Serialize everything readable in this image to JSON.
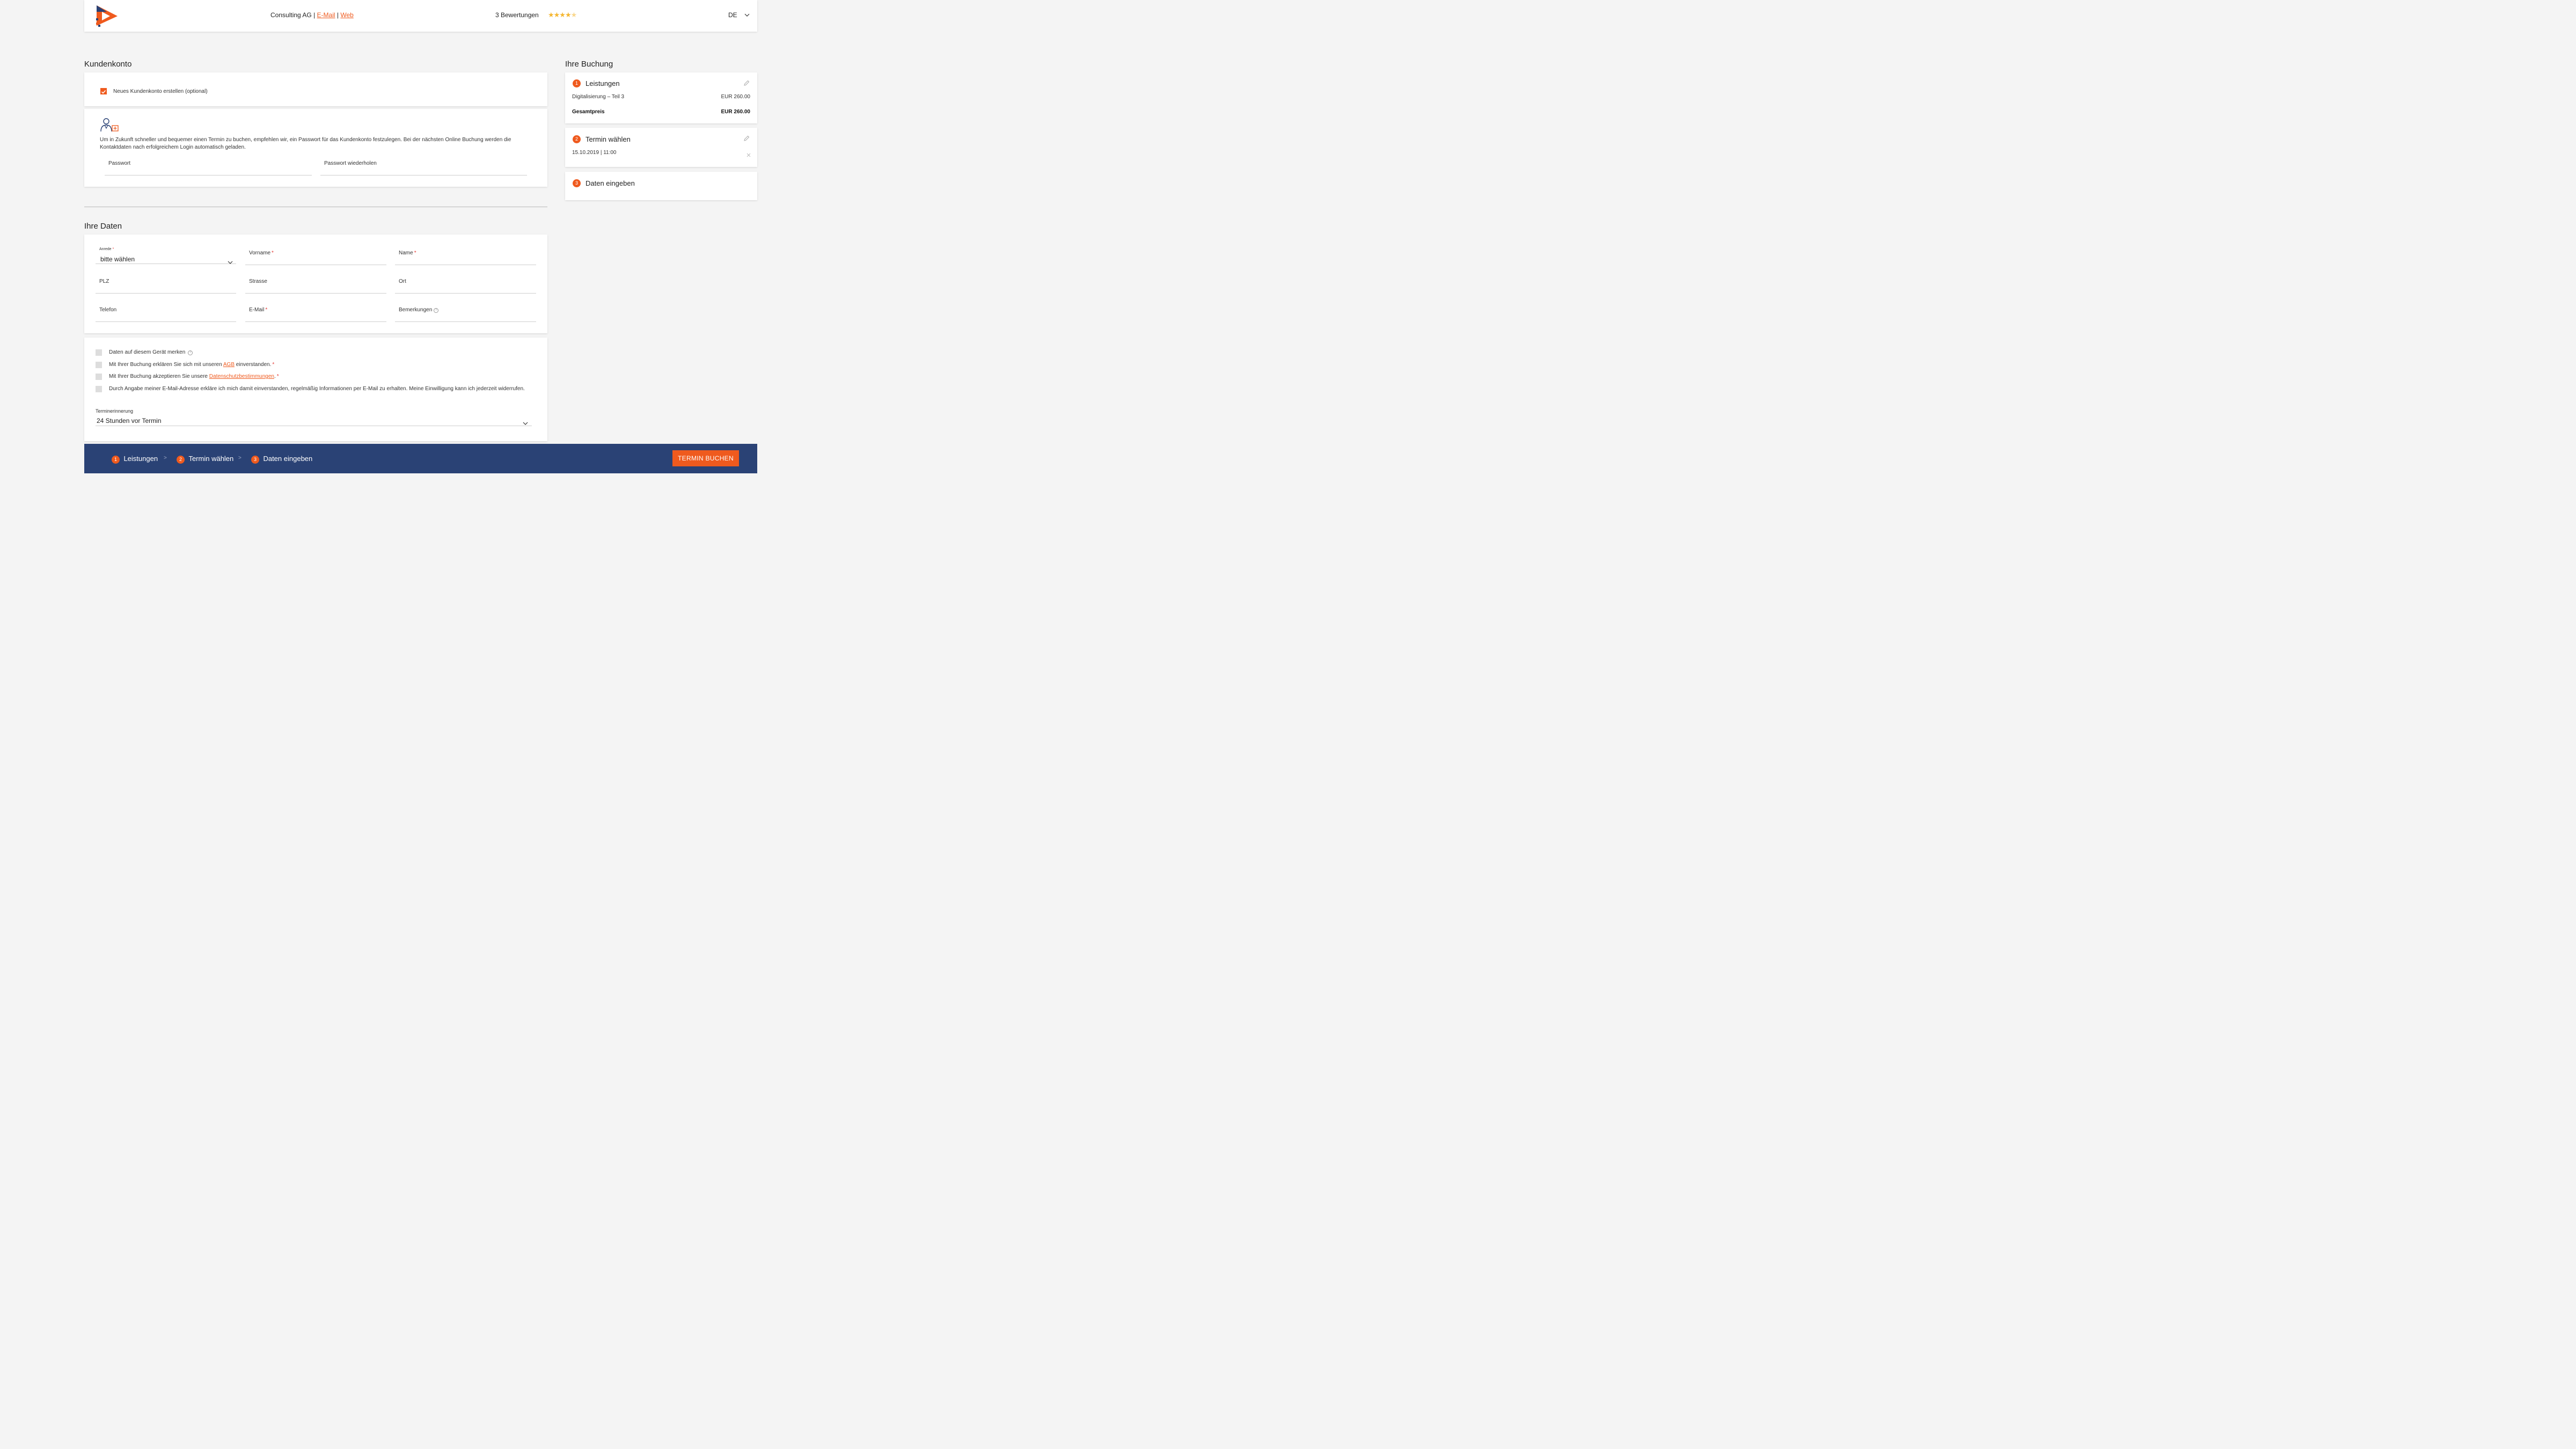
{
  "header": {
    "company": "Consulting AG",
    "sep": "|",
    "email_link": "E-Mail",
    "web_link": "Web",
    "ratings_text": "3 Bewertungen",
    "rating_stars": 4.5,
    "language": "DE"
  },
  "account": {
    "title": "Kundenkonto",
    "create_checkbox_label": "Neues Kundenkonto erstellen (optional)",
    "create_checked": true,
    "info_text": "Um in Zukunft schneller und bequemer einen Termin zu buchen, empfehlen wir, ein Passwort für das Kundenkonto festzulegen. Bei der nächsten Online Buchung werden die Kontaktdaten nach erfolgreichem Login automatisch geladen.",
    "password_label": "Passwort",
    "password_repeat_label": "Passwort wiederholen"
  },
  "data": {
    "title": "Ihre Daten",
    "salutation_label": "Anrede",
    "salutation_value": "bitte wählen",
    "firstname_label": "Vorname",
    "lastname_label": "Name",
    "zip_label": "PLZ",
    "street_label": "Strasse",
    "city_label": "Ort",
    "phone_label": "Telefon",
    "email_label": "E-Mail",
    "remarks_label": "Bemerkungen",
    "required_mark": "*"
  },
  "consents": {
    "remember": "Daten auf diesem Gerät merken",
    "agb_prefix": "Mit Ihrer Buchung erklären Sie sich mit unseren",
    "agb_link": "AGB",
    "agb_suffix": "einverstanden.",
    "privacy_prefix": "Mit Ihrer Buchung akzeptieren Sie unsere",
    "privacy_link": "Datenschutzbestimmungen",
    "privacy_suffix": ".",
    "newsletter": "Durch Angabe meiner E-Mail-Adresse erkläre ich mich damit einverstanden, regelmäßig Informationen per E-Mail zu erhalten. Meine Einwilligung kann ich jederzeit widerrufen.",
    "reminder_label": "Terminerinnerung",
    "reminder_value": "24 Stunden vor Termin"
  },
  "booking": {
    "title": "Ihre Buchung",
    "steps": [
      {
        "num": "1",
        "title": "Leistungen",
        "item": "Digitalisierung – Teil 3",
        "item_price": "EUR 260.00",
        "total_label": "Gesamtpreis",
        "total_price": "EUR 260.00"
      },
      {
        "num": "2",
        "title": "Termin wählen",
        "datetime": "15.10.2019 | 11:00"
      },
      {
        "num": "3",
        "title": "Daten eingeben"
      }
    ]
  },
  "footer": {
    "steps": [
      {
        "num": "1",
        "label": "Leistungen"
      },
      {
        "num": "2",
        "label": "Termin wählen"
      },
      {
        "num": "3",
        "label": "Daten eingeben"
      }
    ],
    "separator": ">",
    "book_button": "TERMIN BUCHEN"
  },
  "colors": {
    "accent": "#ef5a1e",
    "footer_bg": "#2a4275",
    "star": "#f5b731"
  }
}
